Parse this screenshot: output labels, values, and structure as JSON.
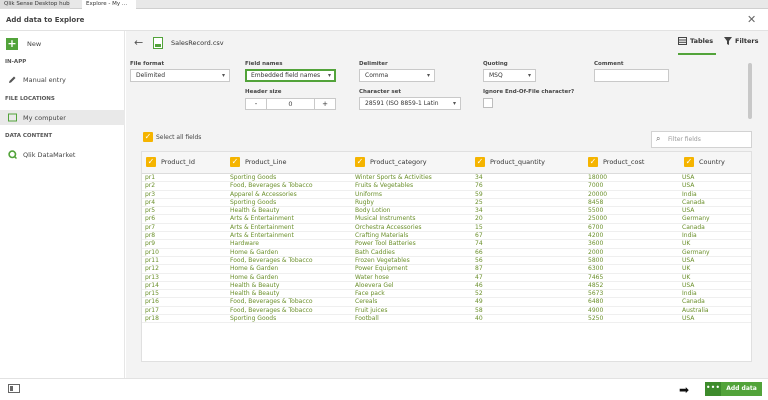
{
  "browser_tabs": [
    {
      "label": "Qlik Sense Desktop hub"
    },
    {
      "label": "Explore - My ..."
    }
  ],
  "dialog": {
    "title": "Add data to Explore"
  },
  "sidebar": {
    "new_label": "New",
    "sections": [
      {
        "heading": "IN-APP",
        "items": [
          {
            "label": "Manual entry",
            "icon": "pencil-icon"
          }
        ]
      },
      {
        "heading": "FILE LOCATIONS",
        "items": [
          {
            "label": "My computer",
            "icon": "folder-icon",
            "active": true
          }
        ]
      },
      {
        "heading": "DATA CONTENT",
        "items": [
          {
            "label": "Qlik DataMarket",
            "icon": "qlik-icon"
          }
        ]
      }
    ]
  },
  "main": {
    "file_name": "SalesRecord.csv",
    "tabs": {
      "tables": "Tables",
      "filters": "Filters"
    },
    "options": {
      "file_format": {
        "label": "File format",
        "value": "Delimited"
      },
      "field_names": {
        "label": "Field names",
        "value": "Embedded field names"
      },
      "delimiter": {
        "label": "Delimiter",
        "value": "Comma"
      },
      "quoting": {
        "label": "Quoting",
        "value": "MSQ"
      },
      "comment": {
        "label": "Comment",
        "value": ""
      },
      "header_size": {
        "label": "Header size",
        "value": "0",
        "minus": "-",
        "plus": "+"
      },
      "character_set": {
        "label": "Character set",
        "value": "28591 (ISO 8859-1 Latin"
      },
      "ignore_eof": {
        "label": "Ignore End-Of-File character?"
      }
    },
    "select_all_label": "Select all fields",
    "filter_placeholder": "Filter fields"
  },
  "table": {
    "columns": [
      "Product_Id",
      "Product_Line",
      "Product_category",
      "Product_quantity",
      "Product_cost",
      "Country"
    ],
    "rows": [
      [
        "pr1",
        "Sporting Goods",
        "Winter Sports & Activities",
        "34",
        "18000",
        "USA"
      ],
      [
        "pr2",
        "Food, Beverages & Tobacco",
        "Fruits & Vegetables",
        "76",
        "7000",
        "USA"
      ],
      [
        "pr3",
        "Apparel & Accessories",
        "Uniforms",
        "59",
        "20000",
        "India"
      ],
      [
        "pr4",
        "Sporting Goods",
        "Rugby",
        "25",
        "8458",
        "Canada"
      ],
      [
        "pr5",
        "Health & Beauty",
        "Body Lotion",
        "34",
        "5500",
        "USA"
      ],
      [
        "pr6",
        "Arts & Entertainment",
        "Musical Instruments",
        "20",
        "25000",
        "Germany"
      ],
      [
        "pr7",
        "Arts & Entertainment",
        "Orchestra Accessories",
        "15",
        "6700",
        "Canada"
      ],
      [
        "pr8",
        "Arts & Entertainment",
        "Crafting Materials",
        "67",
        "4200",
        "India"
      ],
      [
        "pr9",
        "Hardware",
        "Power Tool Batteries",
        "74",
        "3600",
        "UK"
      ],
      [
        "pr10",
        "Home & Garden",
        "Bath Caddies",
        "66",
        "2000",
        "Germany"
      ],
      [
        "pr11",
        "Food, Beverages & Tobacco",
        "Frozen Vegetables",
        "56",
        "5800",
        "USA"
      ],
      [
        "pr12",
        "Home & Garden",
        "Power Equipment",
        "87",
        "6300",
        "UK"
      ],
      [
        "pr13",
        "Home & Garden",
        "Water hose",
        "47",
        "7465",
        "UK"
      ],
      [
        "pr14",
        "Health & Beauty",
        "Aloevera Gel",
        "46",
        "4852",
        "USA"
      ],
      [
        "pr15",
        "Health & Beauty",
        "Face pack",
        "52",
        "5673",
        "India"
      ],
      [
        "pr16",
        "Food, Beverages & Tobacco",
        "Cereals",
        "49",
        "6480",
        "Canada"
      ],
      [
        "pr17",
        "Food, Beverages & Tobacco",
        "Fruit juices",
        "58",
        "4900",
        "Australia"
      ],
      [
        "pr18",
        "Sporting Goods",
        "Football",
        "40",
        "5250",
        "USA"
      ]
    ]
  },
  "footer": {
    "add_data_label": "Add data",
    "more_label": "•••"
  },
  "colors": {
    "accent_green": "#52a33a",
    "check_yellow": "#f5b400",
    "cell_text": "#6a8f2a"
  }
}
